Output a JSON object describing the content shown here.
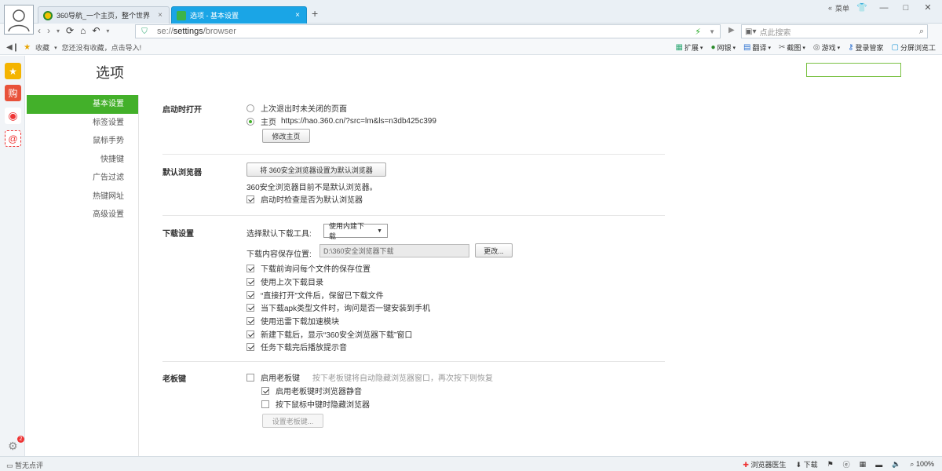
{
  "tabs": [
    {
      "title": "360导航_一个主页，整个世界",
      "close": "×"
    },
    {
      "title": "选项 - 基本设置",
      "close": "×"
    }
  ],
  "newtab": "+",
  "window": {
    "menu_label": "菜单",
    "min": "—",
    "max": "□",
    "close": "✕",
    "chevrons": "«"
  },
  "address": {
    "scheme": "se://",
    "host": "settings",
    "path": "/browser"
  },
  "search": {
    "placeholder": "点此搜索"
  },
  "bookmarks": {
    "fav_label": "收藏",
    "hint": "您还没有收藏，点击导入!"
  },
  "toolbar_right": [
    {
      "icon": "extension-icon",
      "label": "扩展"
    },
    {
      "icon": "bank-icon",
      "label": "网银"
    },
    {
      "icon": "translate-icon",
      "label": "翻译"
    },
    {
      "icon": "screenshot-icon",
      "label": "截图"
    },
    {
      "icon": "game-icon",
      "label": "游戏"
    },
    {
      "icon": "key-icon",
      "label": "登录管家"
    },
    {
      "icon": "split-screen-icon",
      "label": "分屏浏览工"
    }
  ],
  "settings": {
    "title": "选项",
    "nav": [
      "基本设置",
      "标签设置",
      "鼠标手势",
      "快捷键",
      "广告过滤",
      "热键网址",
      "高级设置"
    ],
    "startup": {
      "title": "启动时打开",
      "opt1": "上次退出时未关闭的页面",
      "opt2": "主页",
      "homepage_url": "https://hao.360.cn/?src=lm&ls=n3db425c399",
      "change_btn": "修改主页"
    },
    "default_browser": {
      "title": "默认浏览器",
      "btn": "将 360安全浏览器设置为默认浏览器",
      "status": "360安全浏览器目前不是默认浏览器。",
      "check_label": "启动时检查是否为默认浏览器"
    },
    "download": {
      "title": "下载设置",
      "tool_label": "选择默认下载工具:",
      "tool_value": "使用内建下载",
      "path_label": "下载内容保存位置:",
      "path_value": "D:\\360安全浏览器下载",
      "change_btn": "更改...",
      "options": [
        "下载前询问每个文件的保存位置",
        "使用上次下载目录",
        "“直接打开”文件后，保留已下载文件",
        "当下载apk类型文件时，询问是否一键安装到手机",
        "使用迅雷下载加速模块",
        "新建下载后，显示“360安全浏览器下载”窗口",
        "任务下载完后播放提示音"
      ]
    },
    "boss_key": {
      "title": "老板键",
      "enable_label": "启用老板键",
      "hint": "按下老板键将自动隐藏浏览器窗口，再次按下则恢复",
      "mute_label": "启用老板键时浏览器静音",
      "middle_label": "按下鼠标中键时隐藏浏览器",
      "set_btn": "设置老板键..."
    }
  },
  "status": {
    "left": "暂无点评",
    "items": [
      "浏览器医生",
      "下载"
    ],
    "zoom": "100%"
  },
  "notification_count": "2"
}
